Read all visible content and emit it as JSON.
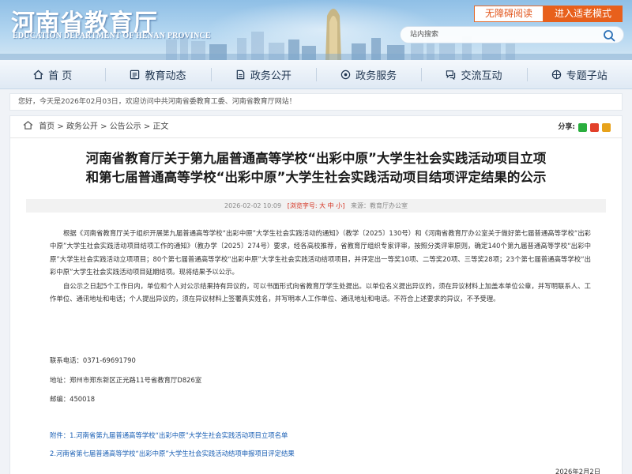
{
  "header": {
    "logo_cn": "河南省教育厅",
    "logo_en": "EDUCATION DEPARTMENT OF HENAN PROVINCE",
    "accessible_label": "无障碍阅读",
    "elder_mode_label": "进入适老模式",
    "search_placeholder": "站内搜索"
  },
  "nav": {
    "items": [
      {
        "label": "首 页",
        "icon": "home-icon"
      },
      {
        "label": "教育动态",
        "icon": "news-icon"
      },
      {
        "label": "政务公开",
        "icon": "document-icon"
      },
      {
        "label": "政务服务",
        "icon": "service-icon"
      },
      {
        "label": "交流互动",
        "icon": "interaction-icon"
      },
      {
        "label": "专题子站",
        "icon": "topics-icon"
      }
    ]
  },
  "welcome_text": "您好，今天是2026年02月03日，欢迎访问中共河南省委教育工委、河南省教育厅网站！",
  "breadcrumb": {
    "items": [
      "首页",
      "政务公开",
      "公告公示",
      "正文"
    ],
    "separator": " > "
  },
  "share_label": "分享:",
  "colors": {
    "accent": "#e8601c",
    "link": "#1a5fb4",
    "highlight": "#d4301f"
  },
  "article": {
    "title_line1": "河南省教育厅关于第九届普通高等学校“出彩中原”大学生社会实践活动项目立项",
    "title_line2": "和第七届普通高等学校“出彩中原”大学生社会实践活动项目结项评定结果的公示",
    "date": "2026-02-02 10:09",
    "font_size_label": "[浏览字号:",
    "font_sizes": [
      "大",
      "中",
      "小"
    ],
    "font_size_end": "]",
    "source": "来源：教育厅办公室",
    "paragraphs": [
      "根据《河南省教育厅关于组织开展第九届普通高等学校“出彩中原”大学生社会实践活动的通知》（教学〔2025〕130号）和《河南省教育厅办公室关于做好第七届普通高等学校“出彩中原”大学生社会实践活动项目结项工作的通知》（教办学〔2025〕274号）要求，经各高校推荐，省教育厅组织专家评审，按照分类评审原则，确定140个第九届普通高等学校“出彩中原”大学生社会实践活动立项项目；80个第七届普通高等学校“出彩中原”大学生社会实践活动结项项目，并评定出一等奖10项、二等奖20项、三等奖28项；23个第七届普通高等学校“出彩中原”大学生社会实践活动项目延期结项。现将结果予以公示。",
      "自公示之日起5个工作日内，单位和个人对公示结果持有异议的，可以书面形式向省教育厅学生处提出。以单位名义提出异议的，须在异议材料上加盖本单位公章，并写明联系人、工作单位、通讯地址和电话；个人提出异议的，须在异议材料上签署真实姓名，并写明本人工作单位、通讯地址和电话。不符合上述要求的异议，不予受理。"
    ],
    "contact_phone": "联系电话：0371-69691790",
    "contact_address": "地址：郑州市郑东新区正光路11号省教育厅D826室",
    "contact_zip": "邮编：450018",
    "attachment_1": "附件：1.河南省第九届普通高等学校“出彩中原”大学生社会实践活动项目立项名单",
    "attachment_2": "2.河南省第七届普通高等学校“出彩中原”大学生社会实践活动结项申报项目评定结果",
    "sign_date": "2026年2月2日"
  }
}
